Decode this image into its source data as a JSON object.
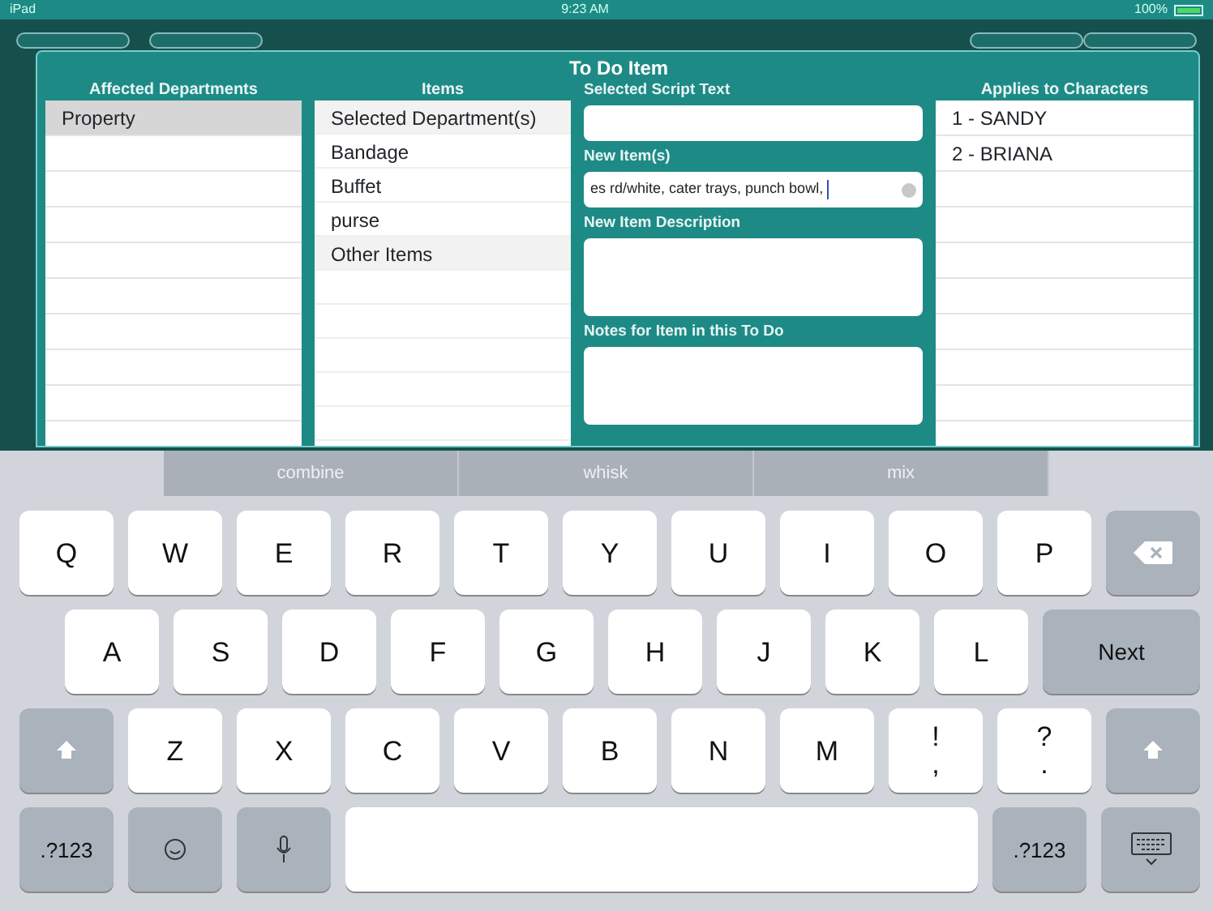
{
  "status_bar": {
    "device": "iPad",
    "time": "9:23 AM",
    "battery": "100%"
  },
  "dialog": {
    "title": "To Do Item",
    "departments": {
      "heading": "Affected Departments",
      "items": [
        {
          "label": "Property",
          "selected": true
        }
      ]
    },
    "items": {
      "heading": "Items",
      "rows": [
        {
          "label": "Selected Department(s)",
          "kind": "header"
        },
        {
          "label": "Bandage",
          "kind": "item"
        },
        {
          "label": "Buffet",
          "kind": "item"
        },
        {
          "label": "purse",
          "kind": "item"
        },
        {
          "label": "Other Items",
          "kind": "header"
        }
      ]
    },
    "fields": [
      {
        "label": "Selected Script Text",
        "kind": "line"
      },
      {
        "label": "New Item(s)",
        "kind": "line",
        "value": "es rd/white, cater trays, punch bowl,",
        "focused": true
      },
      {
        "label": "New Item Description",
        "kind": "area"
      },
      {
        "label": "Notes for Item in this To Do",
        "kind": "area"
      }
    ],
    "characters": {
      "heading": "Applies to Characters",
      "items": [
        {
          "label": "1 - SANDY"
        },
        {
          "label": "2 - BRIANA"
        }
      ]
    }
  },
  "keyboard": {
    "suggestions": [
      "combine",
      "whisk",
      "mix"
    ],
    "rows": [
      {
        "keys": [
          {
            "label": "Q",
            "kind": "letter"
          },
          {
            "label": "W",
            "kind": "letter"
          },
          {
            "label": "E",
            "kind": "letter"
          },
          {
            "label": "R",
            "kind": "letter"
          },
          {
            "label": "T",
            "kind": "letter"
          },
          {
            "label": "Y",
            "kind": "letter"
          },
          {
            "label": "U",
            "kind": "letter"
          },
          {
            "label": "I",
            "kind": "letter"
          },
          {
            "label": "O",
            "kind": "letter"
          },
          {
            "label": "P",
            "kind": "letter"
          },
          {
            "kind": "backspace"
          }
        ]
      },
      {
        "keys": [
          {
            "label": "A",
            "kind": "letter"
          },
          {
            "label": "S",
            "kind": "letter"
          },
          {
            "label": "D",
            "kind": "letter"
          },
          {
            "label": "F",
            "kind": "letter"
          },
          {
            "label": "G",
            "kind": "letter"
          },
          {
            "label": "H",
            "kind": "letter"
          },
          {
            "label": "J",
            "kind": "letter"
          },
          {
            "label": "K",
            "kind": "letter"
          },
          {
            "label": "L",
            "kind": "letter"
          },
          {
            "label": "Next",
            "kind": "return"
          }
        ]
      },
      {
        "keys": [
          {
            "kind": "shift"
          },
          {
            "label": "Z",
            "kind": "letter"
          },
          {
            "label": "X",
            "kind": "letter"
          },
          {
            "label": "C",
            "kind": "letter"
          },
          {
            "label": "V",
            "kind": "letter"
          },
          {
            "label": "B",
            "kind": "letter"
          },
          {
            "label": "N",
            "kind": "letter"
          },
          {
            "label": "M",
            "kind": "letter"
          },
          {
            "label": "!",
            "label2": ",",
            "kind": "dual"
          },
          {
            "label": "?",
            "label2": ".",
            "kind": "dual"
          },
          {
            "kind": "shift"
          }
        ]
      },
      {
        "keys": [
          {
            "label": ".?123",
            "kind": "mode"
          },
          {
            "kind": "emoji"
          },
          {
            "kind": "mic"
          },
          {
            "kind": "space"
          },
          {
            "label": ".?123",
            "kind": "mode"
          },
          {
            "kind": "hide"
          }
        ]
      }
    ]
  }
}
